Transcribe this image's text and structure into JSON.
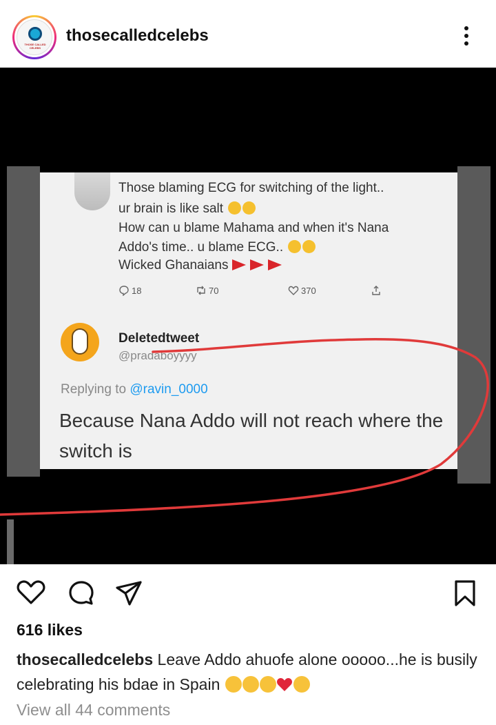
{
  "header": {
    "username": "thosecalledcelebs",
    "avatar_caption": "THOSE CALLED CELEBS"
  },
  "post": {
    "tweet1": {
      "lines": [
        "Those blaming ECG for switching of the light..",
        "ur brain is like salt",
        "How can u blame Mahama and when it's Nana",
        "Addo's time.. u blame ECG..",
        "Wicked Ghanaians"
      ],
      "replies": "18",
      "retweets": "70",
      "likes": "370"
    },
    "tweet2": {
      "name": "Deletedtweet",
      "handle": "@pradaboyyyy",
      "replying_prefix": "Replying to ",
      "replying_to": "@ravin_0000",
      "body": "Because Nana Addo will not reach where the switch is"
    },
    "annotation_color": "#e03a3a"
  },
  "actions": {
    "icons": [
      "heart-icon",
      "comment-icon",
      "share-icon",
      "bookmark-icon"
    ]
  },
  "likes_text": "616 likes",
  "caption": {
    "user": "thosecalledcelebs",
    "text": " Leave Addo ahuofe alone ooooo...he is busily celebrating his bdae in Spain "
  },
  "view_comments": "View all 44 comments"
}
